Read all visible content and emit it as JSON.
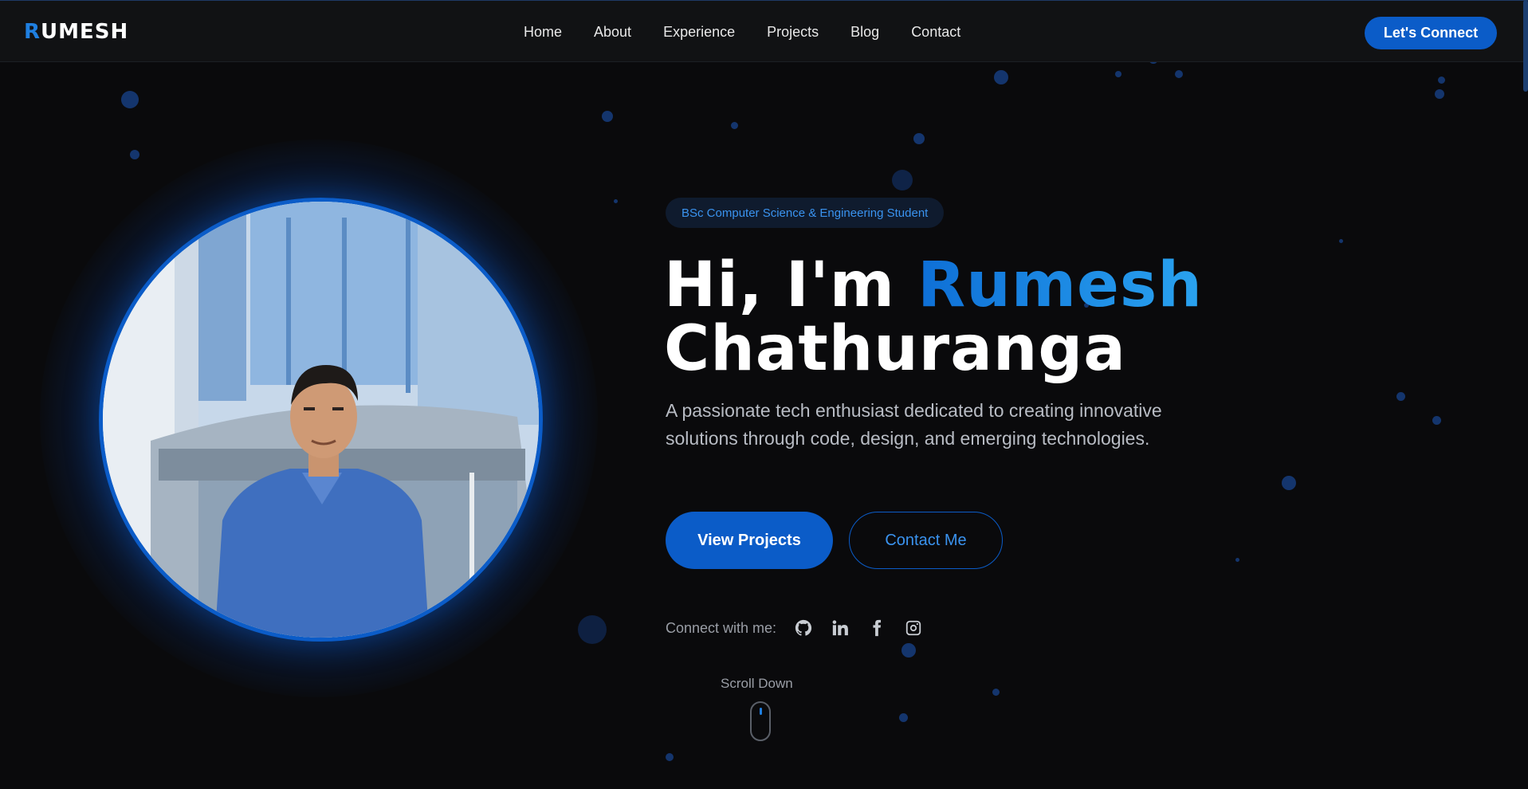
{
  "nav": {
    "logo_initial": "R",
    "logo_rest": "UMESH",
    "links": [
      "Home",
      "About",
      "Experience",
      "Projects",
      "Blog",
      "Contact"
    ],
    "cta": "Let's Connect"
  },
  "hero": {
    "badge": "BSc Computer Science & Engineering Student",
    "greeting": "Hi, I'm",
    "first_name": "Rumesh",
    "last_name": "Chathuranga",
    "description": "A passionate tech enthusiast dedicated to creating innovative solutions through code, design, and emerging technologies.",
    "primary_button": "View Projects",
    "secondary_button": "Contact Me",
    "connect_label": "Connect with me:",
    "socials": [
      "github-icon",
      "linkedin-icon",
      "facebook-icon",
      "instagram-icon"
    ],
    "scroll_label": "Scroll Down"
  },
  "colors": {
    "accent": "#0b5cc8",
    "accent_light": "#3a93ef",
    "background": "#0a0a0c",
    "nav_background": "#111214"
  }
}
